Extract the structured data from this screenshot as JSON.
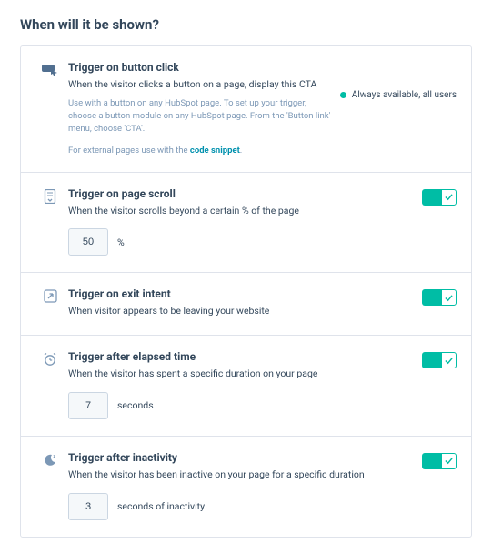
{
  "title": "When will it be shown?",
  "availability_label": "Always available, all users",
  "code_snippet_label": "code snippet",
  "sections": {
    "button_click": {
      "title": "Trigger on button click",
      "desc": "When the visitor clicks a button on a page, display this CTA",
      "hint": "Use with a button on any HubSpot page. To set up your trigger, choose a button module on any HubSpot page. From the 'Button link' menu, choose 'CTA'.",
      "external_prefix": "For external pages use with the "
    },
    "page_scroll": {
      "title": "Trigger on page scroll",
      "desc": "When the visitor scrolls beyond a certain % of the page",
      "value": "50",
      "unit": "%"
    },
    "exit_intent": {
      "title": "Trigger on exit intent",
      "desc": "When visitor appears to be leaving your website"
    },
    "elapsed_time": {
      "title": "Trigger after elapsed time",
      "desc": "When the visitor has spent a specific duration on your page",
      "value": "7",
      "unit": "seconds"
    },
    "inactivity": {
      "title": "Trigger after inactivity",
      "desc": "When the visitor has been inactive on your page for a specific duration",
      "value": "3",
      "unit": "seconds of inactivity"
    }
  }
}
